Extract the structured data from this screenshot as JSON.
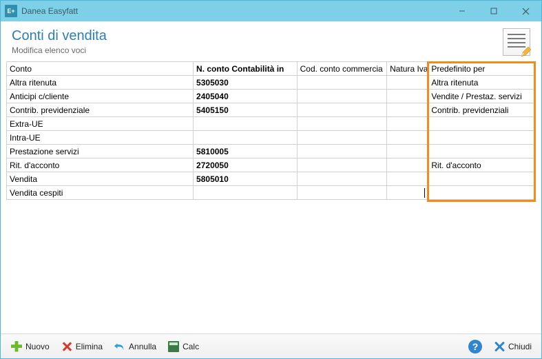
{
  "titlebar": {
    "app_name": "Danea Easyfatt"
  },
  "header": {
    "title": "Conti di vendita",
    "subtitle": "Modifica elenco voci"
  },
  "grid": {
    "columns": {
      "conto": "Conto",
      "n_conto": "N. conto Contabilità in",
      "cod_conto": "Cod. conto commercia",
      "natura": "Natura Iva",
      "predef": "Predefinito per"
    },
    "rows": [
      {
        "conto": "Altra ritenuta",
        "n_conto": "5305030",
        "cod": "",
        "natura": "",
        "predef": "Altra ritenuta"
      },
      {
        "conto": "Anticipi c/cliente",
        "n_conto": "2405040",
        "cod": "",
        "natura": "",
        "predef": "Vendite / Prestaz. servizi"
      },
      {
        "conto": "Contrib. previdenziale",
        "n_conto": "5405150",
        "cod": "",
        "natura": "",
        "predef": "Contrib. previdenziali"
      },
      {
        "conto": "Extra-UE",
        "n_conto": "",
        "cod": "",
        "natura": "",
        "predef": ""
      },
      {
        "conto": "Intra-UE",
        "n_conto": "",
        "cod": "",
        "natura": "",
        "predef": ""
      },
      {
        "conto": "Prestazione servizi",
        "n_conto": "5810005",
        "cod": "",
        "natura": "",
        "predef": ""
      },
      {
        "conto": "Rit. d'acconto",
        "n_conto": "2720050",
        "cod": "",
        "natura": "",
        "predef": "Rit. d'acconto"
      },
      {
        "conto": "Vendita",
        "n_conto": "5805010",
        "cod": "",
        "natura": "",
        "predef": ""
      },
      {
        "conto": "Vendita cespiti",
        "n_conto": "",
        "cod": "",
        "natura": "",
        "predef": "",
        "editing_natura": true
      }
    ]
  },
  "toolbar": {
    "new_label": "Nuovo",
    "delete_label": "Elimina",
    "undo_label": "Annulla",
    "calc_label": "Calc",
    "close_label": "Chiudi",
    "help_glyph": "?"
  },
  "icons": {
    "app_badge": "E+"
  }
}
